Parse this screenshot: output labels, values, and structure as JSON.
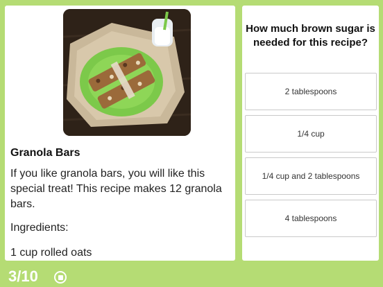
{
  "recipe": {
    "title": "Granola Bars",
    "intro": "If you like granola bars, you will like this special treat! This recipe makes 12 granola bars.",
    "ingredients_label": "Ingredients:",
    "ingredients": [
      "1 cup rolled oats"
    ]
  },
  "quiz": {
    "question": "How much brown sugar is needed for this recipe?",
    "answers": [
      "2 tablespoons",
      "1/4 cup",
      "1/4 cup and 2 tablespoons",
      "4 tablespoons"
    ]
  },
  "footer": {
    "progress": "3/10",
    "stop_icon": "stop-circle-icon"
  },
  "colors": {
    "background": "#b5dc74",
    "card": "#ffffff",
    "plate": "#7cc94a"
  }
}
